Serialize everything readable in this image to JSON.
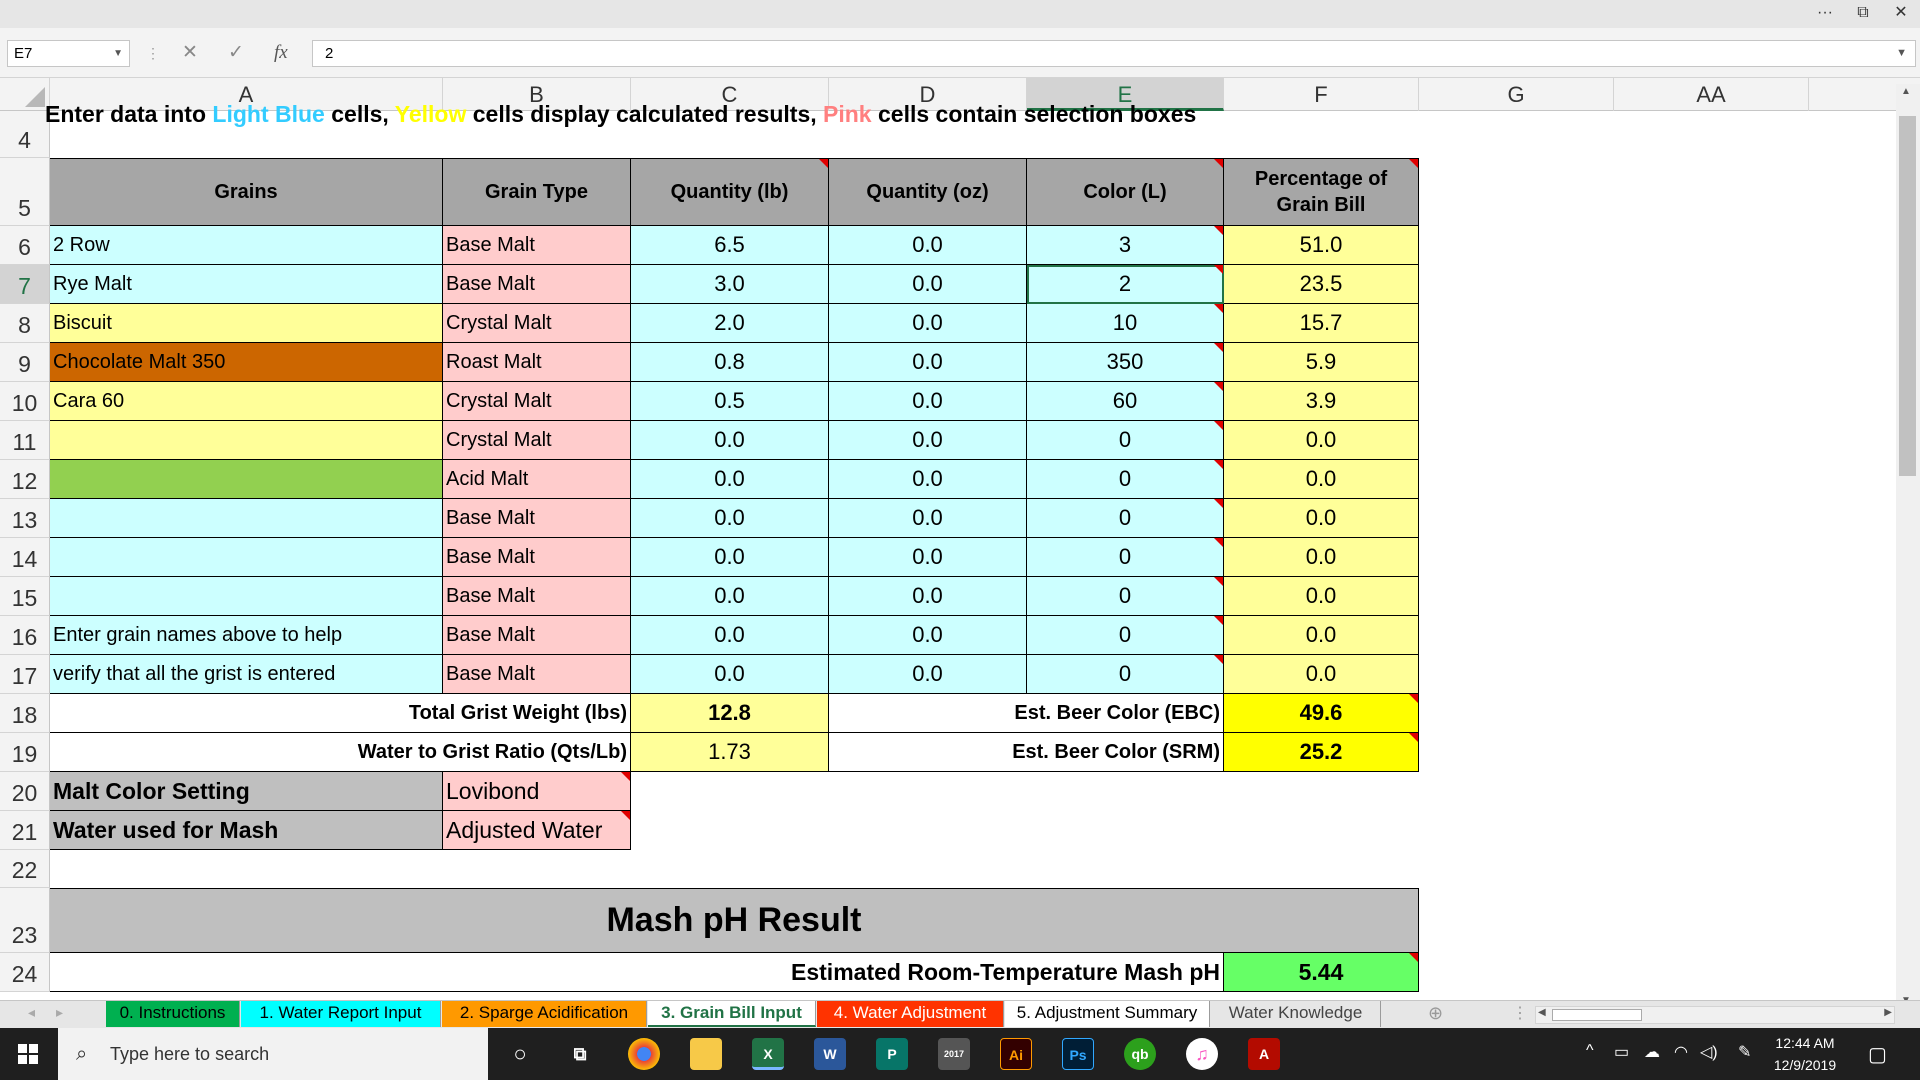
{
  "formula_bar": {
    "name_box": "E7",
    "formula": "2"
  },
  "columns": [
    "A",
    "B",
    "C",
    "D",
    "E",
    "F",
    "G",
    "AA"
  ],
  "row_numbers": [
    "4",
    "5",
    "6",
    "7",
    "8",
    "9",
    "10",
    "11",
    "12",
    "13",
    "14",
    "15",
    "16",
    "17",
    "18",
    "19",
    "20",
    "21",
    "22",
    "23",
    "24"
  ],
  "instructions": {
    "prefix": "Enter data into ",
    "light_blue": "Light Blue",
    "mid1": " cells, ",
    "yellow": "Yellow",
    "mid2": " cells display calculated results, ",
    "pink": "Pink",
    "suffix": " cells contain selection boxes"
  },
  "headers": {
    "grains": "Grains",
    "grain_type": "Grain Type",
    "qty_lb": "Quantity (lb)",
    "qty_oz": "Quantity (oz)",
    "color": "Color (L)",
    "pct": "Percentage of Grain Bill"
  },
  "grain_rows": [
    {
      "name": "2 Row",
      "type": "Base Malt",
      "lb": "6.5",
      "oz": "0.0",
      "color": "3",
      "pct": "51.0"
    },
    {
      "name": "Rye Malt",
      "type": "Base Malt",
      "lb": "3.0",
      "oz": "0.0",
      "color": "2",
      "pct": "23.5"
    },
    {
      "name": "Biscuit",
      "type": "Crystal Malt",
      "lb": "2.0",
      "oz": "0.0",
      "color": "10",
      "pct": "15.7"
    },
    {
      "name": "Chocolate Malt 350",
      "type": "Roast Malt",
      "lb": "0.8",
      "oz": "0.0",
      "color": "350",
      "pct": "5.9"
    },
    {
      "name": "Cara 60",
      "type": "Crystal Malt",
      "lb": "0.5",
      "oz": "0.0",
      "color": "60",
      "pct": "3.9"
    },
    {
      "name": "",
      "type": "Crystal Malt",
      "lb": "0.0",
      "oz": "0.0",
      "color": "0",
      "pct": "0.0"
    },
    {
      "name": "",
      "type": "Acid Malt",
      "lb": "0.0",
      "oz": "0.0",
      "color": "0",
      "pct": "0.0"
    },
    {
      "name": "",
      "type": "Base Malt",
      "lb": "0.0",
      "oz": "0.0",
      "color": "0",
      "pct": "0.0"
    },
    {
      "name": "",
      "type": "Base Malt",
      "lb": "0.0",
      "oz": "0.0",
      "color": "0",
      "pct": "0.0"
    },
    {
      "name": "",
      "type": "Base Malt",
      "lb": "0.0",
      "oz": "0.0",
      "color": "0",
      "pct": "0.0"
    },
    {
      "name": "Enter grain names above to help",
      "type": "Base Malt",
      "lb": "0.0",
      "oz": "0.0",
      "color": "0",
      "pct": "0.0"
    },
    {
      "name": "verify that all the grist is entered",
      "type": "Base Malt",
      "lb": "0.0",
      "oz": "0.0",
      "color": "0",
      "pct": "0.0"
    }
  ],
  "totals": {
    "grist_label": "Total Grist Weight (lbs)",
    "grist_value": "12.8",
    "ebc_label": "Est. Beer Color (EBC)",
    "ebc_value": "49.6",
    "ratio_label": "Water to Grist Ratio (Qts/Lb)",
    "ratio_value": "1.73",
    "srm_label": "Est. Beer Color (SRM)",
    "srm_value": "25.2"
  },
  "settings": {
    "malt_color_label": "Malt Color Setting",
    "malt_color_value": "Lovibond",
    "water_label": "Water used for Mash",
    "water_value": "Adjusted Water"
  },
  "mash": {
    "title": "Mash pH Result",
    "ph_label": "Estimated Room-Temperature Mash pH",
    "ph_value": "5.44"
  },
  "sheet_tabs": [
    {
      "label": "0. Instructions",
      "color": "#00b050"
    },
    {
      "label": "1. Water Report Input",
      "color": "#00ffff"
    },
    {
      "label": "2. Sparge Acidification",
      "color": "#ff9900"
    },
    {
      "label": "3. Grain Bill Input",
      "color": "#ffffff"
    },
    {
      "label": "4. Water Adjustment",
      "color": "#ff3300"
    },
    {
      "label": "5. Adjustment Summary",
      "color": "#ffffff"
    },
    {
      "label": "Water Knowledge",
      "color": "#e6e6e6"
    }
  ],
  "taskbar": {
    "search_placeholder": "Type here to search",
    "time": "12:44 AM",
    "date": "12/9/2019"
  },
  "colors": {
    "light_blue": "#ccffff",
    "yellow": "#ffff99",
    "pink": "#ffcccc",
    "header_gray": "#a6a6a6",
    "excel_green": "#217346"
  }
}
